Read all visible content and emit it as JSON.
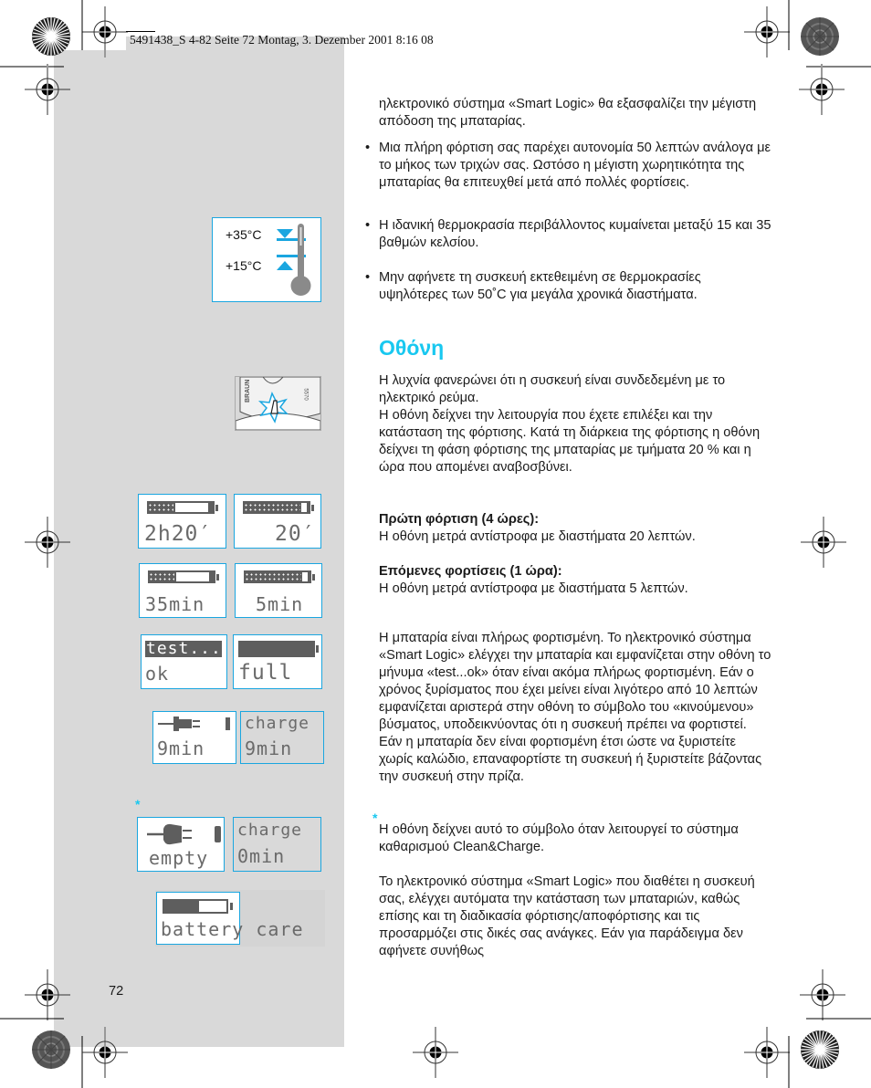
{
  "slug_line": "5491438_S 4-82  Seite 72  Montag, 3. Dezember 2001  8:16 08",
  "page_number": "72",
  "colors": {
    "accent": "#19c8f0",
    "figure_border": "#1aa6e0",
    "panel_gray": "#d9d9d9",
    "lcd_gray": "#5e5e5e"
  },
  "intro": {
    "paragraph": "ηλεκτρονικό σύστημα «Smart Logic» θα εξασφαλίζει την μέγιστη απόδοση της μπαταρίας."
  },
  "bullets": [
    "Μια πλήρη φόρτιση σας παρέχει αυτονομία 50 λεπτών ανάλογα με το μήκος των τριχών σας. Ωστόσο η μέγιστη χωρητικότητα της μπαταρίας θα επιτευχθεί μετά από πολλές φορτίσεις.",
    "Η ιδανική θερμοκρασία περιβάλλοντος κυμαίνεται μεταξύ 15 και 35 βαθμών κελσίου.",
    "Μην αφήνετε τη συσκευή εκτεθειμένη σε θερμοκρασίες υψηλότερες των 50˚C για μεγάλα χρονικά διαστήματα."
  ],
  "bullet_symbol": "•",
  "section": {
    "heading": "Οθόνη",
    "p1": "Η λυχνία φανερώνει ότι η συσκευή είναι συνδεδεμένη με το ηλεκτρικό ρεύμα.",
    "p2": "Η οθόνη δείχνει την λειτουργία που έχετε επιλέξει και την κατάσταση της φόρτισης. Κατά τη διάρκεια της φόρτισης η οθόνη δείχνει τη φάση φόρτισης της μπαταρίας με τμήματα 20 % και η ώρα που απομένει αναβοσβύνει.",
    "first_charge_title": "Πρώτη φόρτιση (4 ώρες):",
    "first_charge_text": "Η οθόνη μετρά αντίστροφα με διαστήματα 20 λεπτών.",
    "next_charge_title": "Επόμενες φορτίσεις (1 ώρα):",
    "next_charge_text": "Η οθόνη μετρά αντίστροφα με διαστήματα 5 λεπτών.",
    "full_text": "Η μπαταρία είναι πλήρως φορτισμένη. Το ηλεκτρονικό σύστημα «Smart Logic» ελέγχει την μπαταρία και εμφανίζεται στην οθόνη το μήνυμα «test...ok» όταν είναι ακόμα πλήρως φορτισμένη. Εάν ο χρόνος ξυρίσματος που έχει μείνει είναι λιγότερο από 10 λεπτών εμφανίζεται αριστερά στην οθόνη το σύμβολο του «κινούμενου» βύσματος, υποδεικνύοντας ότι η συσκευή πρέπει να φορτιστεί. Εάν η μπαταρία δεν είναι φορτισμένη έτσι ώστε να ξυριστείτε χωρίς καλώδιο, επαναφορτίστε τη συσκευή ή ξυριστείτε βάζοντας την συσκευή στην πρίζα.",
    "star_symbol": "*",
    "clean_text": "Η οθόνη δείχνει αυτό το σύμβολο όταν λειτουργεί το σύστημα καθαρισμού Clean&Charge.",
    "smart_text": "Το ηλεκτρονικό σύστημα «Smart Logic» που διαθέτει η συσκευή σας, ελέγχει αυτόματα την κατάσταση των μπαταριών, καθώς επίσης και τη διαδικασία φόρτισης/αποφόρτισης και τις προσαρμόζει στις δικές σας ανάγκες. Εάν για παράδειγμα δεν αφήνετε συνήθως"
  },
  "figures": {
    "thermometer": {
      "upper_label": "+35°C",
      "lower_label": "+15°C"
    },
    "shaver_lamp": {
      "brand": "BRAUN",
      "model": "5570"
    },
    "lcd": {
      "first_charge": {
        "time": "2h20′",
        "fill": 0.4
      },
      "first_charge_end": {
        "time": "20′",
        "fill": 0.9
      },
      "next_charge": {
        "time": "35min",
        "fill": 0.4
      },
      "next_charge_end": {
        "time": "5min",
        "fill": 0.9
      },
      "test": {
        "line1": "test...",
        "line2": "ok"
      },
      "full": {
        "line2": "full",
        "fill": 1.0
      },
      "low_plug": {
        "line2": "9min"
      },
      "low_charge": {
        "line1": "charge",
        "line2": "9min"
      },
      "empty": {
        "line2": "empty"
      },
      "empty_charge": {
        "line1": "charge",
        "line2": "0min"
      },
      "battery_care": {
        "line2": "battery care",
        "fill": 0.55
      }
    }
  }
}
